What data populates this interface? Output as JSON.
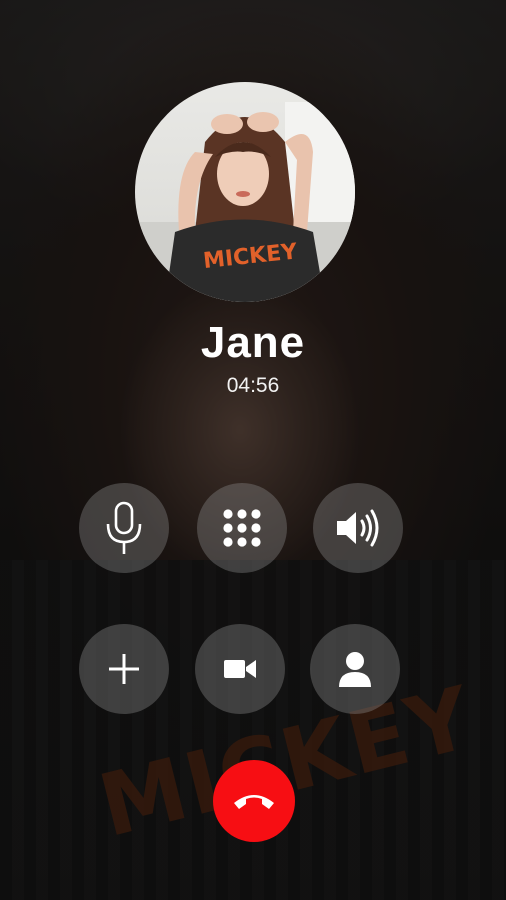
{
  "call": {
    "caller_name": "Jane",
    "timer": "04:56"
  },
  "background": {
    "shirt_text": "MICKEY"
  },
  "avatar": {
    "shirt_text": "MICKEY"
  },
  "controls": [
    {
      "id": "mute",
      "icon": "microphone-icon"
    },
    {
      "id": "keypad",
      "icon": "keypad-icon"
    },
    {
      "id": "speaker",
      "icon": "speaker-icon"
    },
    {
      "id": "add-call",
      "icon": "plus-icon"
    },
    {
      "id": "video",
      "icon": "video-camera-icon"
    },
    {
      "id": "contacts",
      "icon": "person-icon"
    }
  ],
  "end_call": {
    "icon": "phone-hangup-icon",
    "color": "#f70e13"
  },
  "colors": {
    "control_bg": "rgba(140,140,140,0.38)",
    "text": "#ffffff"
  }
}
